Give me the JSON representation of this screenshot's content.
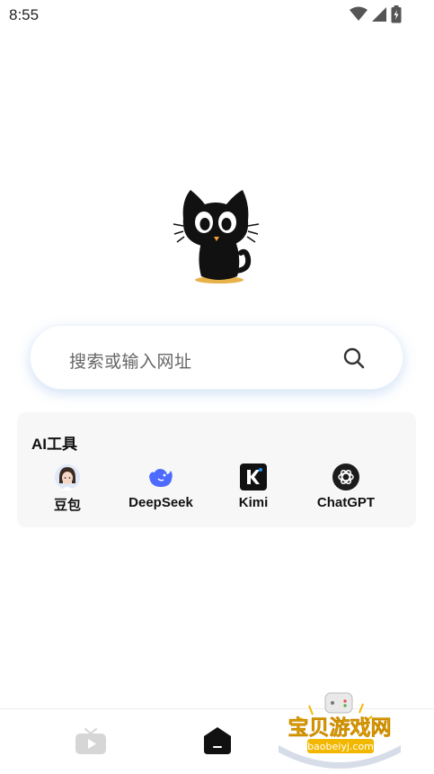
{
  "status_bar": {
    "time": "8:55"
  },
  "search": {
    "placeholder": "搜索或输入网址"
  },
  "ai_tools": {
    "title": "AI工具",
    "items": [
      {
        "label": "豆包",
        "icon": "doubao-avatar-icon"
      },
      {
        "label": "DeepSeek",
        "icon": "deepseek-whale-icon"
      },
      {
        "label": "Kimi",
        "icon": "kimi-k-icon"
      },
      {
        "label": "ChatGPT",
        "icon": "chatgpt-logo-icon"
      }
    ]
  },
  "bottom_nav": {
    "items": [
      "video-icon",
      "home-icon"
    ]
  },
  "watermark": {
    "brand": "宝贝游戏网",
    "url": "baobeiyj.com"
  },
  "colors": {
    "accent_blue": "#4d6bfe",
    "search_shadow": "#b6cff0",
    "card_bg": "#f7f7f8"
  }
}
